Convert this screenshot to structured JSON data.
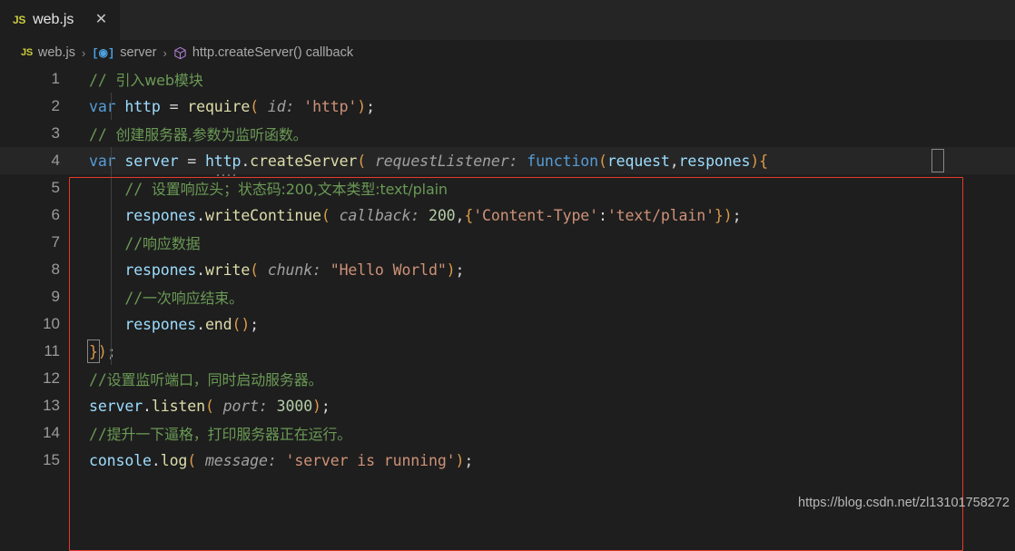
{
  "window": {
    "app": "vscode-editor",
    "background": "#1e1e1e"
  },
  "tabbar": {
    "tabs": [
      {
        "icon": "js-file-icon",
        "icon_label": "JS",
        "label": "web.js",
        "close_label": "✕",
        "active": true
      }
    ]
  },
  "breadcrumb": {
    "file_icon_label": "JS",
    "items": [
      {
        "label": "web.js",
        "icon": "js-file-icon"
      },
      {
        "label": "server",
        "icon": "field-symbol-icon"
      },
      {
        "label": "http.createServer() callback",
        "icon": "cube-symbol-icon"
      }
    ],
    "separator": "›"
  },
  "editor": {
    "language": "javascript",
    "current_line": 4,
    "line_count": 15,
    "lines": [
      {
        "number": "1",
        "tokens": [
          {
            "t": "// ",
            "c": "t-cmt"
          },
          {
            "t": "引入web模块",
            "c": "t-cmt cmt-cn"
          }
        ]
      },
      {
        "number": "2",
        "tokens": [
          {
            "t": "var",
            "c": "t-kw"
          },
          {
            "t": " ",
            "c": "t-op"
          },
          {
            "t": "http",
            "c": "t-var"
          },
          {
            "t": " ",
            "c": "t-op"
          },
          {
            "t": "=",
            "c": "t-op"
          },
          {
            "t": " ",
            "c": "t-op"
          },
          {
            "t": "require",
            "c": "t-fn"
          },
          {
            "t": "(",
            "c": "t-paren"
          },
          {
            "t": " ",
            "c": "t-op"
          },
          {
            "t": "id:",
            "c": "t-param"
          },
          {
            "t": " ",
            "c": "t-op"
          },
          {
            "t": "'http'",
            "c": "t-str"
          },
          {
            "t": ")",
            "c": "t-paren"
          },
          {
            "t": ";",
            "c": "t-punct"
          }
        ]
      },
      {
        "number": "3",
        "tokens": [
          {
            "t": "// ",
            "c": "t-cmt"
          },
          {
            "t": "创建服务器,参数为监听函数。",
            "c": "t-cmt cmt-cn"
          }
        ]
      },
      {
        "number": "4",
        "tokens": [
          {
            "t": "var",
            "c": "t-kw"
          },
          {
            "t": " ",
            "c": "t-op"
          },
          {
            "t": "server",
            "c": "t-var"
          },
          {
            "t": " ",
            "c": "t-op"
          },
          {
            "t": "=",
            "c": "t-op"
          },
          {
            "t": " ",
            "c": "t-op"
          },
          {
            "t": "http",
            "c": "t-var"
          },
          {
            "t": ".",
            "c": "t-punct"
          },
          {
            "t": "createServer",
            "c": "t-fn"
          },
          {
            "t": "(",
            "c": "t-paren"
          },
          {
            "t": " ",
            "c": "t-op"
          },
          {
            "t": "requestListener:",
            "c": "t-param"
          },
          {
            "t": " ",
            "c": "t-op"
          },
          {
            "t": "function",
            "c": "t-kw"
          },
          {
            "t": "(",
            "c": "t-paren"
          },
          {
            "t": "request",
            "c": "t-var"
          },
          {
            "t": ",",
            "c": "t-punct"
          },
          {
            "t": "respones",
            "c": "t-var"
          },
          {
            "t": ")",
            "c": "t-paren"
          },
          {
            "t": "{",
            "c": "t-brace1"
          }
        ]
      },
      {
        "number": "5",
        "tokens": [
          {
            "t": "    // ",
            "c": "t-cmt"
          },
          {
            "t": "设置响应头；状态码:200,文本类型:text/plain",
            "c": "t-cmt cmt-cn"
          }
        ]
      },
      {
        "number": "6",
        "tokens": [
          {
            "t": "    ",
            "c": "t-op"
          },
          {
            "t": "respones",
            "c": "t-var"
          },
          {
            "t": ".",
            "c": "t-punct"
          },
          {
            "t": "writeContinue",
            "c": "t-fn"
          },
          {
            "t": "(",
            "c": "t-paren"
          },
          {
            "t": " ",
            "c": "t-op"
          },
          {
            "t": "callback:",
            "c": "t-param"
          },
          {
            "t": " ",
            "c": "t-op"
          },
          {
            "t": "200",
            "c": "t-num"
          },
          {
            "t": ",",
            "c": "t-punct"
          },
          {
            "t": "{",
            "c": "t-paren"
          },
          {
            "t": "'Content-Type'",
            "c": "t-str"
          },
          {
            "t": ":",
            "c": "t-punct"
          },
          {
            "t": "'text/plain'",
            "c": "t-str"
          },
          {
            "t": "}",
            "c": "t-paren"
          },
          {
            "t": ")",
            "c": "t-paren"
          },
          {
            "t": ";",
            "c": "t-punct"
          }
        ]
      },
      {
        "number": "7",
        "tokens": [
          {
            "t": "    //",
            "c": "t-cmt"
          },
          {
            "t": "响应数据",
            "c": "t-cmt cmt-cn"
          }
        ]
      },
      {
        "number": "8",
        "tokens": [
          {
            "t": "    ",
            "c": "t-op"
          },
          {
            "t": "respones",
            "c": "t-var"
          },
          {
            "t": ".",
            "c": "t-punct"
          },
          {
            "t": "write",
            "c": "t-fn"
          },
          {
            "t": "(",
            "c": "t-paren"
          },
          {
            "t": " ",
            "c": "t-op"
          },
          {
            "t": "chunk:",
            "c": "t-param"
          },
          {
            "t": " ",
            "c": "t-op"
          },
          {
            "t": "\"Hello World\"",
            "c": "t-str"
          },
          {
            "t": ")",
            "c": "t-paren"
          },
          {
            "t": ";",
            "c": "t-punct"
          }
        ]
      },
      {
        "number": "9",
        "tokens": [
          {
            "t": "    //",
            "c": "t-cmt"
          },
          {
            "t": "一次响应结束。",
            "c": "t-cmt cmt-cn"
          }
        ]
      },
      {
        "number": "10",
        "tokens": [
          {
            "t": "    ",
            "c": "t-op"
          },
          {
            "t": "respones",
            "c": "t-var"
          },
          {
            "t": ".",
            "c": "t-punct"
          },
          {
            "t": "end",
            "c": "t-fn"
          },
          {
            "t": "(",
            "c": "t-paren"
          },
          {
            "t": ")",
            "c": "t-paren"
          },
          {
            "t": ";",
            "c": "t-punct"
          }
        ]
      },
      {
        "number": "11",
        "tokens": [
          {
            "t": "}",
            "c": "t-brace1"
          },
          {
            "t": ")",
            "c": "t-paren"
          },
          {
            "t": ";",
            "c": "t-punct"
          }
        ]
      },
      {
        "number": "12",
        "tokens": [
          {
            "t": "//",
            "c": "t-cmt"
          },
          {
            "t": "设置监听端口，同时启动服务器。",
            "c": "t-cmt cmt-cn"
          }
        ]
      },
      {
        "number": "13",
        "tokens": [
          {
            "t": "server",
            "c": "t-var"
          },
          {
            "t": ".",
            "c": "t-punct"
          },
          {
            "t": "listen",
            "c": "t-fn"
          },
          {
            "t": "(",
            "c": "t-paren"
          },
          {
            "t": " ",
            "c": "t-op"
          },
          {
            "t": "port:",
            "c": "t-param"
          },
          {
            "t": " ",
            "c": "t-op"
          },
          {
            "t": "3000",
            "c": "t-num"
          },
          {
            "t": ")",
            "c": "t-paren"
          },
          {
            "t": ";",
            "c": "t-punct"
          }
        ]
      },
      {
        "number": "14",
        "tokens": [
          {
            "t": "//",
            "c": "t-cmt"
          },
          {
            "t": "提升一下逼格，打印服务器正在运行。",
            "c": "t-cmt cmt-cn"
          }
        ]
      },
      {
        "number": "15",
        "tokens": [
          {
            "t": "console",
            "c": "t-var"
          },
          {
            "t": ".",
            "c": "t-punct"
          },
          {
            "t": "log",
            "c": "t-fn"
          },
          {
            "t": "(",
            "c": "t-paren"
          },
          {
            "t": " ",
            "c": "t-op"
          },
          {
            "t": "message:",
            "c": "t-param"
          },
          {
            "t": " ",
            "c": "t-op"
          },
          {
            "t": "'server is running'",
            "c": "t-str"
          },
          {
            "t": ")",
            "c": "t-paren"
          },
          {
            "t": ";",
            "c": "t-punct"
          }
        ]
      }
    ]
  },
  "annotation": {
    "type": "red-rectangle",
    "color": "#e8392c"
  },
  "watermark": {
    "text": "https://blog.csdn.net/zl13101758272"
  }
}
